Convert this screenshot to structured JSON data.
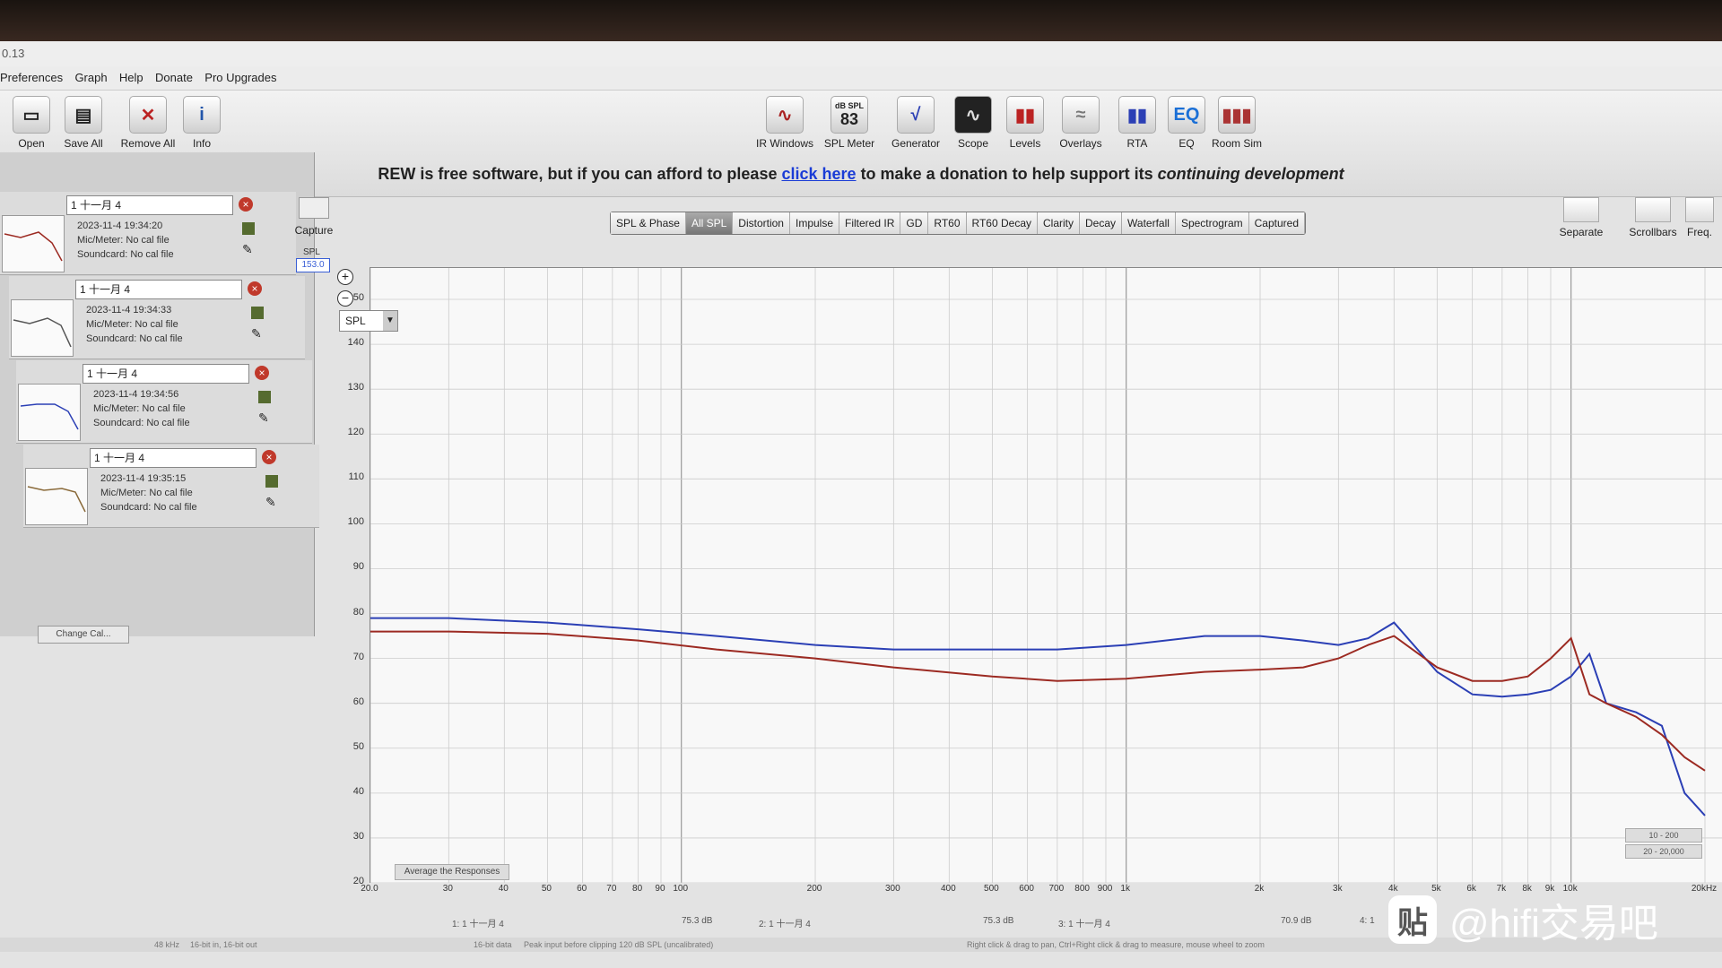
{
  "app": {
    "title_fragment": "0.13"
  },
  "menu": [
    "Preferences",
    "Graph",
    "Help",
    "Donate",
    "Pro Upgrades"
  ],
  "toolbar_left": [
    {
      "label": "Open",
      "icon": "folder-icon"
    },
    {
      "label": "Save All",
      "icon": "save-icon"
    },
    {
      "label": "Remove All",
      "icon": "remove-icon"
    },
    {
      "label": "Info",
      "icon": "info-icon"
    }
  ],
  "toolbar_center": [
    {
      "label": "IR Windows",
      "icon": "ir-windows-icon"
    },
    {
      "label": "SPL Meter",
      "icon": "spl-meter-icon",
      "value": "83",
      "unit": "dB SPL"
    },
    {
      "label": "Generator",
      "icon": "generator-icon"
    },
    {
      "label": "Scope",
      "icon": "scope-icon"
    },
    {
      "label": "Levels",
      "icon": "levels-icon"
    },
    {
      "label": "Overlays",
      "icon": "overlays-icon"
    },
    {
      "label": "RTA",
      "icon": "rta-icon"
    },
    {
      "label": "EQ",
      "icon": "eq-icon"
    },
    {
      "label": "Room Sim",
      "icon": "room-sim-icon"
    }
  ],
  "donate": {
    "prefix": "REW is free software, but if you can afford to please",
    "link": "click here",
    "suffix_plain": "to make a donation to help support its",
    "suffix_italic": "continuing development"
  },
  "measurements": [
    {
      "name": "1 十一月 4",
      "date": "2023-11-4 19:34:20",
      "mic": "Mic/Meter: No cal file",
      "sound": "Soundcard: No cal file"
    },
    {
      "name": "1 十一月 4",
      "date": "2023-11-4 19:34:33",
      "mic": "Mic/Meter: No cal file",
      "sound": "Soundcard: No cal file"
    },
    {
      "name": "1 十一月 4",
      "date": "2023-11-4 19:34:56",
      "mic": "Mic/Meter: No cal file",
      "sound": "Soundcard: No cal file"
    },
    {
      "name": "1 十一月 4",
      "date": "2023-11-4 19:35:15",
      "mic": "Mic/Meter: No cal file",
      "sound": "Soundcard: No cal file"
    }
  ],
  "change_cal": "Change Cal...",
  "capture_label": "Capture",
  "graph_tabs": [
    "SPL & Phase",
    "All SPL",
    "Distortion",
    "Impulse",
    "Filtered IR",
    "GD",
    "RT60",
    "RT60 Decay",
    "Clarity",
    "Decay",
    "Waterfall",
    "Spectrogram",
    "Captured"
  ],
  "active_tab": "All SPL",
  "right_buttons": [
    {
      "label": "Separate",
      "icon": "separate-icon"
    },
    {
      "label": "Scrollbars",
      "icon": "scrollbars-icon"
    },
    {
      "label": "Freq.",
      "icon": "freq-icon"
    }
  ],
  "y_axis": {
    "title": "SPL",
    "readout": "153.0"
  },
  "spl_select": "SPL",
  "average_button": "Average the Responses",
  "legend": [
    {
      "label": "1: 1 十一月 4",
      "value": "75.3 dB"
    },
    {
      "label": "2: 1 十一月 4",
      "value": "75.3 dB"
    },
    {
      "label": "3: 1 十一月 4",
      "value": "70.9 dB"
    },
    {
      "label": "4: 1",
      "value": ""
    }
  ],
  "right_scale": [
    "10 - 200",
    "20 - 20,000"
  ],
  "status": {
    "rate": "48 kHz",
    "bits": "16-bit in, 16-bit out",
    "data": "16-bit data",
    "peak": "Peak input before clipping 120 dB SPL (uncalibrated)",
    "hint": "Right click & drag to pan, Ctrl+Right click & drag to measure, mouse wheel to zoom"
  },
  "watermark": {
    "logo": "贴",
    "text": "@hifi交易吧"
  },
  "colors": {
    "blue": "#2b3fb5",
    "red": "#9c2a22",
    "link": "#1a3cd6"
  },
  "chart_data": {
    "type": "line",
    "xscale": "log",
    "xlim": [
      20,
      20000
    ],
    "ylim": [
      20,
      153
    ],
    "y_ticks": [
      20,
      30,
      40,
      50,
      60,
      70,
      80,
      90,
      100,
      110,
      120,
      130,
      140,
      150
    ],
    "x_ticks": [
      "20.0",
      "30",
      "40",
      "50",
      "60",
      "70",
      "80",
      "90",
      "100",
      "200",
      "300",
      "400",
      "500",
      "600",
      "700",
      "800",
      "900",
      "1k",
      "2k",
      "3k",
      "4k",
      "5k",
      "6k",
      "7k",
      "8k",
      "9k",
      "10k",
      "20kHz"
    ],
    "series": [
      {
        "color": "#2b3fb5",
        "x": [
          20,
          30,
          50,
          80,
          120,
          200,
          300,
          500,
          700,
          1000,
          1500,
          2000,
          2500,
          3000,
          3500,
          4000,
          5000,
          6000,
          7000,
          8000,
          9000,
          10000,
          11000,
          12000,
          14000,
          16000,
          18000,
          20000
        ],
        "y": [
          79,
          79,
          78,
          76.5,
          75,
          73,
          72,
          72,
          72,
          73,
          75,
          75,
          74,
          73,
          74.5,
          78,
          67,
          62,
          61.5,
          62,
          63,
          66,
          71,
          60,
          58,
          55,
          40,
          35
        ]
      },
      {
        "color": "#9c2a22",
        "x": [
          20,
          30,
          50,
          80,
          120,
          200,
          300,
          500,
          700,
          1000,
          1500,
          2000,
          2500,
          3000,
          3500,
          4000,
          5000,
          6000,
          7000,
          8000,
          9000,
          10000,
          11000,
          12000,
          14000,
          16000,
          18000,
          20000
        ],
        "y": [
          76,
          76,
          75.5,
          74,
          72,
          70,
          68,
          66,
          65,
          65.5,
          67,
          67.5,
          68,
          70,
          73,
          75,
          68,
          65,
          65,
          66,
          70,
          74.5,
          62,
          60,
          57,
          53,
          48,
          45
        ]
      }
    ]
  }
}
